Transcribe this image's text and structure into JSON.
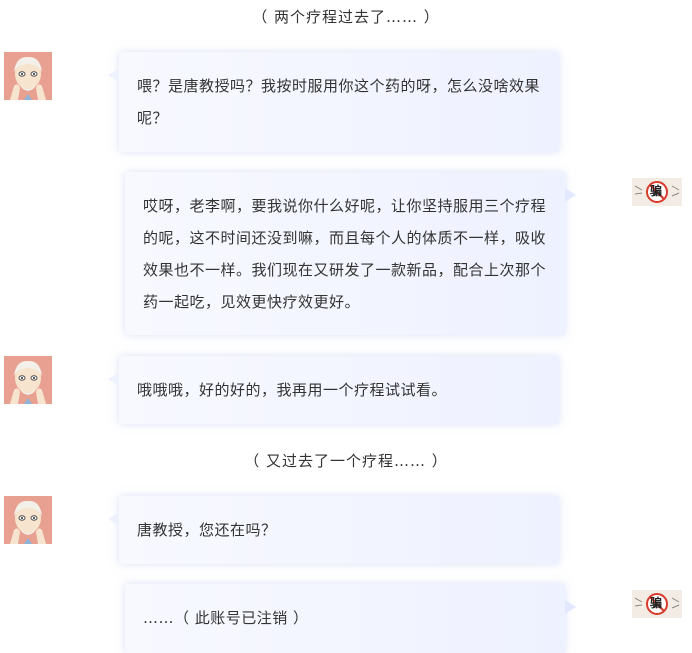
{
  "narration": {
    "first": "（ 两个疗程过去了…… ）",
    "second": "（ 又过去了一个疗程…… ）"
  },
  "messages": [
    {
      "sender": "old-li",
      "text": "喂？是唐教授吗？我按时服用你这个药的呀，怎么没啥效果呢？"
    },
    {
      "sender": "professor-tang",
      "text": "哎呀，老李啊，要我说你什么好呢，让你坚持服用三个疗程的呢，这不时间还没到嘛，而且每个人的体质不一样，吸收效果也不一样。我们现在又研发了一款新品，配合上次那个药一起吃，见效更快疗效更好。"
    },
    {
      "sender": "old-li",
      "text": "哦哦哦，好的好的，我再用一个疗程试试看。"
    },
    {
      "sender": "old-li",
      "text": "唐教授，您还在吗？"
    },
    {
      "sender": "professor-tang",
      "text": "……（ 此账号已注销 ）"
    }
  ],
  "avatars": {
    "old_man_icon": "elderly-man-avatar",
    "scam_icon": "no-scam-stamp-icon",
    "scam_stamp_char": "骗"
  },
  "colors": {
    "bubble_start": "#f8f9ff",
    "bubble_end": "#eef1ff",
    "avatar_bg": "#e8a190",
    "stamp_red": "#d93a2b"
  }
}
